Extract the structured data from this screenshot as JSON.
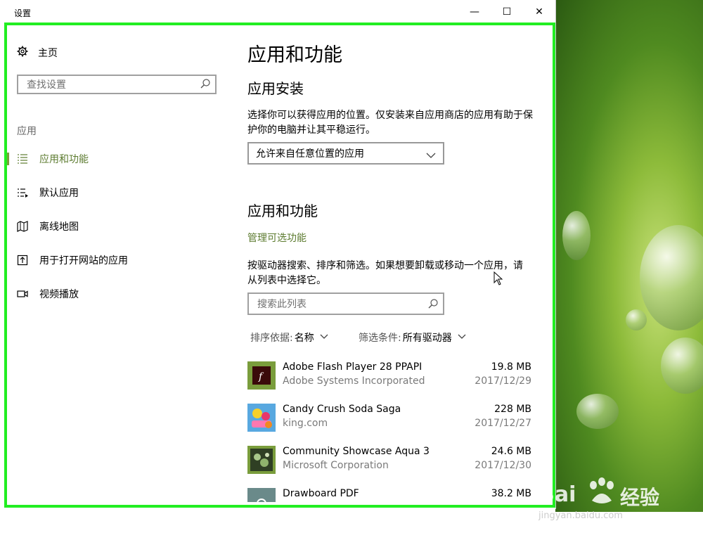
{
  "window": {
    "title": "设置",
    "minimize_glyph": "—",
    "maximize_glyph": "☐",
    "close_glyph": "✕"
  },
  "sidebar": {
    "home_label": "主页",
    "search_placeholder": "查找设置",
    "section_label": "应用",
    "items": [
      {
        "label": "应用和功能",
        "icon": "list-icon",
        "active": true
      },
      {
        "label": "默认应用",
        "icon": "default-apps-icon",
        "active": false
      },
      {
        "label": "离线地图",
        "icon": "map-icon",
        "active": false
      },
      {
        "label": "用于打开网站的应用",
        "icon": "open-website-icon",
        "active": false
      },
      {
        "label": "视频播放",
        "icon": "video-icon",
        "active": false
      }
    ]
  },
  "main": {
    "page_title": "应用和功能",
    "install_heading": "应用安装",
    "install_desc": "选择你可以获得应用的位置。仅安装来自应用商店的应用有助于保护你的电脑并让其平稳运行。",
    "install_select_value": "允许来自任意位置的应用",
    "apps_heading": "应用和功能",
    "manage_link": "管理可选功能",
    "apps_desc": "按驱动器搜索、排序和筛选。如果想要卸载或移动一个应用，请从列表中选择它。",
    "search_list_placeholder": "搜索此列表",
    "sort_label": "排序依据:",
    "sort_value": "名称",
    "filter_label": "筛选条件:",
    "filter_value": "所有驱动器",
    "apps": [
      {
        "name": "Adobe Flash Player 28 PPAPI",
        "publisher": "Adobe Systems Incorporated",
        "size": "19.8 MB",
        "date": "2017/12/29",
        "icon": "flash-icon"
      },
      {
        "name": "Candy Crush Soda Saga",
        "publisher": "king.com",
        "size": "228 MB",
        "date": "2017/12/27",
        "icon": "candy-crush-icon"
      },
      {
        "name": "Community Showcase Aqua 3",
        "publisher": "Microsoft Corporation",
        "size": "24.6 MB",
        "date": "2017/12/30",
        "icon": "aqua-icon"
      },
      {
        "name": "Drawboard PDF",
        "publisher": "",
        "size": "38.2 MB",
        "date": "",
        "icon": "drawboard-icon"
      }
    ]
  },
  "watermark": {
    "brand": "Bai",
    "brand_cn": "经验",
    "url": "jingyan.baidu.com"
  },
  "colors": {
    "accent": "#7a9d3c",
    "frame_highlight": "#22ee22"
  }
}
